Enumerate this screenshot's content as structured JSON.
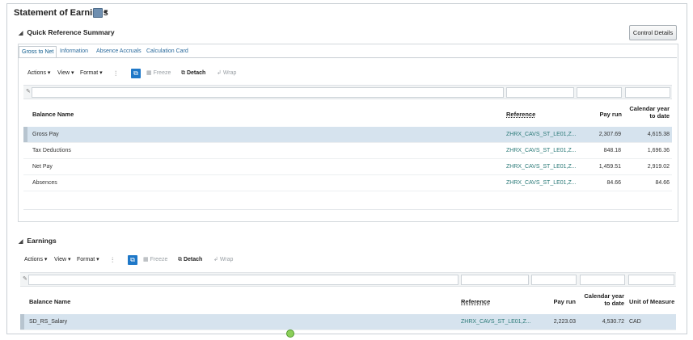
{
  "page": {
    "title": "Statement of Earnings"
  },
  "quick_ref": {
    "heading": "Quick Reference Summary",
    "control_details_label": "Control Details",
    "tabs": [
      {
        "label": "Gross to Net",
        "active": true
      },
      {
        "label": "Information",
        "active": false
      },
      {
        "label": "Absence Accruals",
        "active": false
      },
      {
        "label": "Calculation Card",
        "active": false
      }
    ],
    "toolbar": {
      "actions": "Actions",
      "view": "View",
      "format": "Format",
      "freeze": "Freeze",
      "detach": "Detach",
      "wrap": "Wrap"
    },
    "columns": {
      "balance_name": "Balance Name",
      "reference": "Reference",
      "pay_run": "Pay run",
      "cal_year_1": "Calendar year",
      "cal_year_2": "to date"
    },
    "rows": [
      {
        "name": "Gross Pay",
        "reference": "ZHRX_CAVS_ST_LE01,Z...",
        "pay_run": "2,307.69",
        "ytd": "4,615.38",
        "selected": true
      },
      {
        "name": "Tax Deductions",
        "reference": "ZHRX_CAVS_ST_LE01,Z...",
        "pay_run": "848.18",
        "ytd": "1,696.36",
        "selected": false
      },
      {
        "name": "Net Pay",
        "reference": "ZHRX_CAVS_ST_LE01,Z...",
        "pay_run": "1,459.51",
        "ytd": "2,919.02",
        "selected": false
      },
      {
        "name": "Absences",
        "reference": "ZHRX_CAVS_ST_LE01,Z...",
        "pay_run": "84.66",
        "ytd": "84.66",
        "selected": false
      }
    ]
  },
  "earnings": {
    "heading": "Earnings",
    "toolbar": {
      "actions": "Actions",
      "view": "View",
      "format": "Format",
      "freeze": "Freeze",
      "detach": "Detach",
      "wrap": "Wrap"
    },
    "columns": {
      "balance_name": "Balance Name",
      "reference": "Reference",
      "pay_run": "Pay run",
      "cal_year_1": "Calendar year",
      "cal_year_2": "to date",
      "uom": "Unit of Measure"
    },
    "rows": [
      {
        "name": "SD_RS_Salary",
        "reference": "ZHRX_CAVS_ST_LE01,Z...",
        "pay_run": "2,223.03",
        "ytd": "4,530.72",
        "uom": "CAD",
        "selected": true
      }
    ]
  },
  "icons": {
    "collapse": "triangle-down-icon",
    "dropdown": "caret-down-icon",
    "query": "query-by-example-icon",
    "columns": "manage-columns-icon",
    "freeze": "freeze-icon",
    "detach": "detach-icon",
    "wrap": "wrap-icon",
    "edit": "pencil-icon"
  },
  "colors": {
    "link": "#2b7a78",
    "tab_link": "#2a6a9c",
    "selected_row": "#d6e3ee",
    "accent_button": "#1f78c8"
  }
}
